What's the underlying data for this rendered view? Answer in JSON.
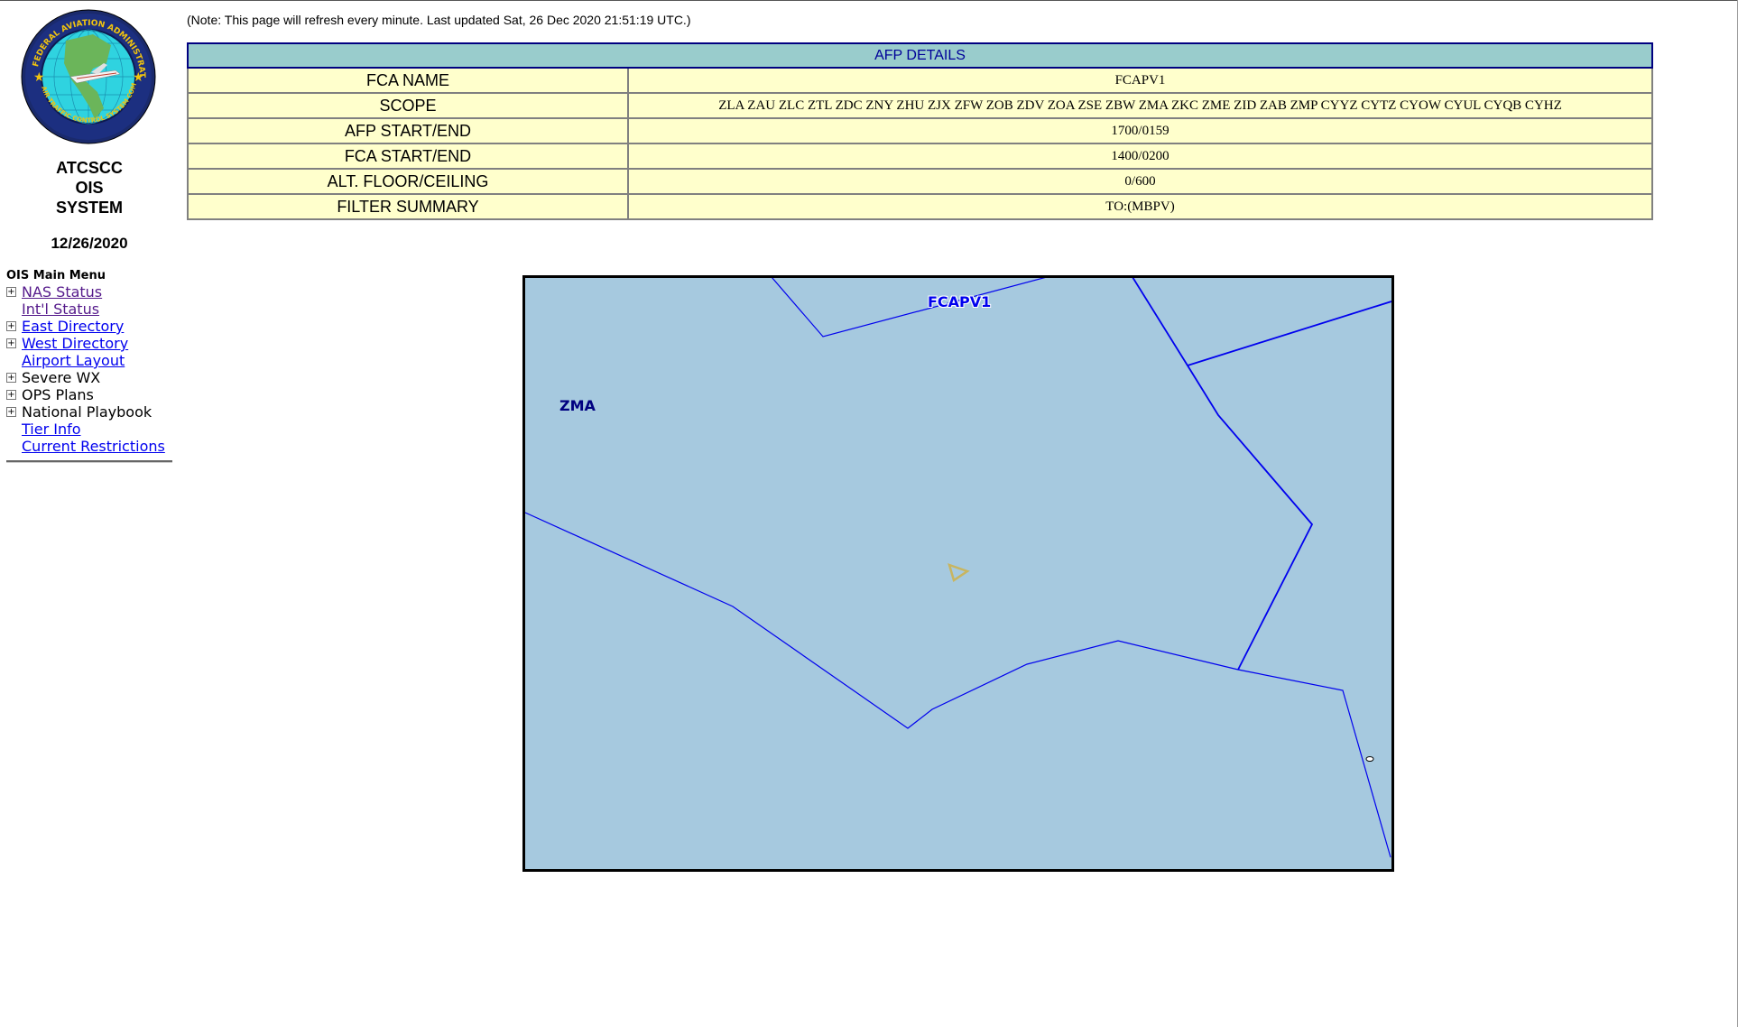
{
  "note": "(Note: This page will refresh every minute.  Last updated Sat, 26 Dec 2020 21:51:19 UTC.)",
  "sidebar": {
    "logo_icon": "faa-atcscc-seal",
    "brand_lines": [
      "ATCSCC",
      "OIS",
      "SYSTEM"
    ],
    "date": "12/26/2020",
    "menu_title": "OIS Main Menu",
    "items": [
      {
        "label": "NAS Status",
        "expandable": true,
        "link": true,
        "visited": true
      },
      {
        "label": "Int'l Status",
        "expandable": false,
        "link": true,
        "visited": true
      },
      {
        "label": "East Directory",
        "expandable": true,
        "link": true,
        "visited": false
      },
      {
        "label": "West Directory",
        "expandable": true,
        "link": true,
        "visited": false
      },
      {
        "label": "Airport Layout",
        "expandable": false,
        "link": true,
        "visited": false
      },
      {
        "label": "Severe WX",
        "expandable": true,
        "link": false,
        "visited": false
      },
      {
        "label": "OPS Plans",
        "expandable": true,
        "link": false,
        "visited": false
      },
      {
        "label": "National Playbook",
        "expandable": true,
        "link": false,
        "visited": false
      },
      {
        "label": "Tier Info",
        "expandable": false,
        "link": true,
        "visited": false
      },
      {
        "label": "Current Restrictions",
        "expandable": false,
        "link": true,
        "visited": false
      }
    ]
  },
  "afp": {
    "title": "AFP DETAILS",
    "rows": [
      {
        "label": "FCA NAME",
        "value": "FCAPV1"
      },
      {
        "label": "SCOPE",
        "value": "ZLA ZAU ZLC ZTL ZDC ZNY ZHU ZJX ZFW ZOB ZDV ZOA ZSE ZBW ZMA ZKC ZME ZID ZAB ZMP CYYZ CYTZ CYOW CYUL CYQB CYHZ"
      },
      {
        "label": "AFP START/END",
        "value": "1700/0159"
      },
      {
        "label": "FCA START/END",
        "value": "1400/0200"
      },
      {
        "label": "ALT. FLOOR/CEILING",
        "value": "0/600"
      },
      {
        "label": "FILTER SUMMARY",
        "value": "TO:(MBPV)"
      }
    ]
  },
  "map": {
    "labels": {
      "center": "ZMA",
      "fca": "FCAPV1"
    },
    "colors": {
      "water": "#a6c9df",
      "boundary": "#0000ee",
      "marker": "#c8b560",
      "label_center": "#000080"
    },
    "marker_icon": "airport-triangle-icon"
  }
}
